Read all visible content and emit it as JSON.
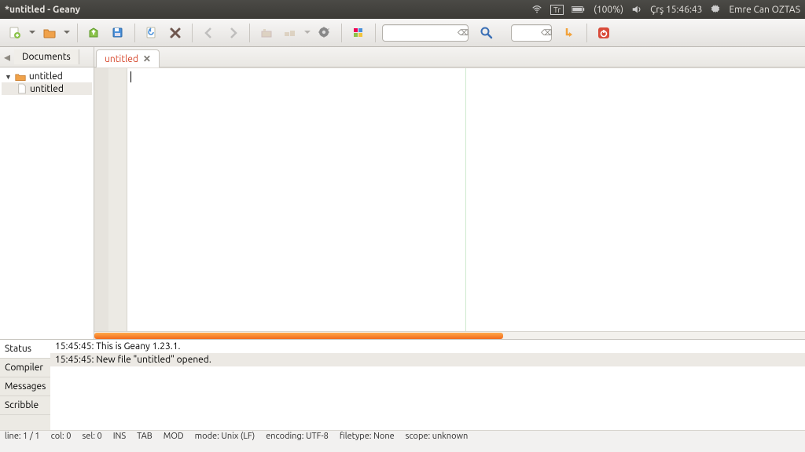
{
  "panel": {
    "title": "*untitled - Geany",
    "keyboard_indicator": "Tr",
    "battery": "(100%)",
    "clock": "Çrş 15:46:43",
    "user": "Emre Can OZTAS"
  },
  "toolbar": {
    "search_placeholder": "",
    "goto_placeholder": ""
  },
  "sidebar": {
    "tab_label": "Documents",
    "root_label": "untitled",
    "file_label": "untitled"
  },
  "editor": {
    "tab_label": "untitled"
  },
  "bottom_tabs": {
    "status": "Status",
    "compiler": "Compiler",
    "messages": "Messages",
    "scribble": "Scribble"
  },
  "messages": {
    "line1": "15:45:45: This is Geany 1.23.1.",
    "line2": "15:45:45: New file \"untitled\" opened."
  },
  "status": {
    "line": "line: 1 / 1",
    "col": "col: 0",
    "sel": "sel: 0",
    "ins": "INS",
    "tab": "TAB",
    "mod": "MOD",
    "mode": "mode: Unix (LF)",
    "encoding": "encoding: UTF-8",
    "filetype": "filetype: None",
    "scope": "scope: unknown"
  }
}
